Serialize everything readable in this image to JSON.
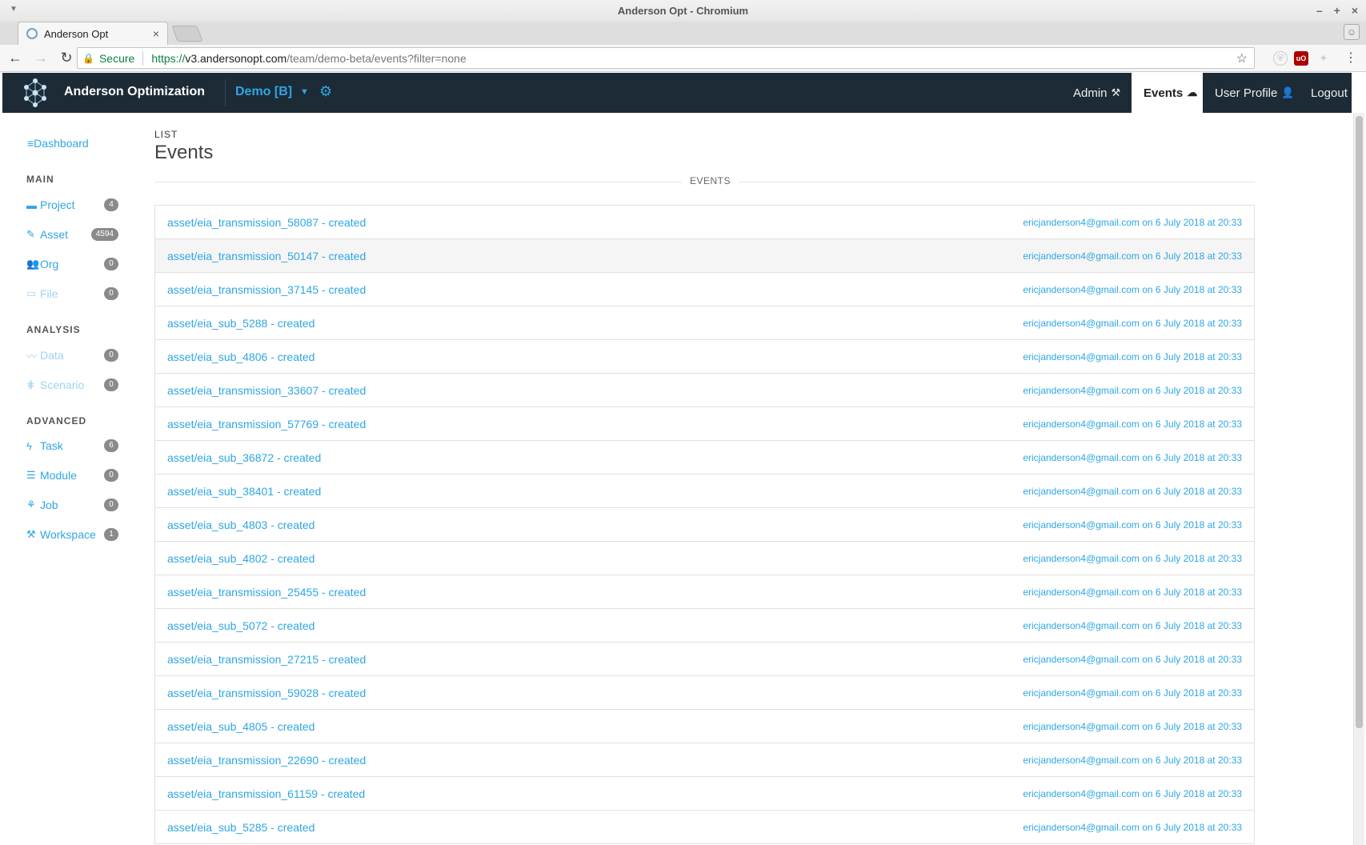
{
  "browser": {
    "window_title": "Anderson Opt - Chromium",
    "tab_title": "Anderson Opt",
    "secure_label": "Secure",
    "url_scheme": "https://",
    "url_host": "v3.andersonopt.com",
    "url_path": "/team/demo-beta/events?filter=none"
  },
  "nav": {
    "brand": "Anderson Optimization",
    "team": "Demo [B]",
    "links": {
      "admin": "Admin",
      "events": "Events",
      "profile": "User Profile",
      "logout": "Logout"
    }
  },
  "sidebar": {
    "dashboard": "Dashboard",
    "sections": {
      "main": "MAIN",
      "analysis": "ANALYSIS",
      "advanced": "ADVANCED"
    },
    "main": [
      {
        "label": "Project",
        "count": "4",
        "icon": "folder-icon"
      },
      {
        "label": "Asset",
        "count": "4594",
        "icon": "pencil-icon"
      },
      {
        "label": "Org",
        "count": "0",
        "icon": "users-icon"
      },
      {
        "label": "File",
        "count": "0",
        "icon": "hdd-icon"
      }
    ],
    "analysis": [
      {
        "label": "Data",
        "count": "0",
        "icon": "chart-icon"
      },
      {
        "label": "Scenario",
        "count": "0",
        "icon": "sliders-icon"
      }
    ],
    "advanced": [
      {
        "label": "Task",
        "count": "6",
        "icon": "bolt-icon"
      },
      {
        "label": "Module",
        "count": "0",
        "icon": "database-icon"
      },
      {
        "label": "Job",
        "count": "0",
        "icon": "sitemap-icon"
      },
      {
        "label": "Workspace",
        "count": "1",
        "icon": "tools-icon"
      }
    ]
  },
  "page": {
    "crumb": "LIST",
    "title": "Events",
    "section_label": "EVENTS"
  },
  "events": [
    {
      "title": "asset/eia_transmission_58087 - created",
      "meta": "ericjanderson4@gmail.com on 6 July 2018 at 20:33"
    },
    {
      "title": "asset/eia_transmission_50147 - created",
      "meta": "ericjanderson4@gmail.com on 6 July 2018 at 20:33"
    },
    {
      "title": "asset/eia_transmission_37145 - created",
      "meta": "ericjanderson4@gmail.com on 6 July 2018 at 20:33"
    },
    {
      "title": "asset/eia_sub_5288 - created",
      "meta": "ericjanderson4@gmail.com on 6 July 2018 at 20:33"
    },
    {
      "title": "asset/eia_sub_4806 - created",
      "meta": "ericjanderson4@gmail.com on 6 July 2018 at 20:33"
    },
    {
      "title": "asset/eia_transmission_33607 - created",
      "meta": "ericjanderson4@gmail.com on 6 July 2018 at 20:33"
    },
    {
      "title": "asset/eia_transmission_57769 - created",
      "meta": "ericjanderson4@gmail.com on 6 July 2018 at 20:33"
    },
    {
      "title": "asset/eia_sub_36872 - created",
      "meta": "ericjanderson4@gmail.com on 6 July 2018 at 20:33"
    },
    {
      "title": "asset/eia_sub_38401 - created",
      "meta": "ericjanderson4@gmail.com on 6 July 2018 at 20:33"
    },
    {
      "title": "asset/eia_sub_4803 - created",
      "meta": "ericjanderson4@gmail.com on 6 July 2018 at 20:33"
    },
    {
      "title": "asset/eia_sub_4802 - created",
      "meta": "ericjanderson4@gmail.com on 6 July 2018 at 20:33"
    },
    {
      "title": "asset/eia_transmission_25455 - created",
      "meta": "ericjanderson4@gmail.com on 6 July 2018 at 20:33"
    },
    {
      "title": "asset/eia_sub_5072 - created",
      "meta": "ericjanderson4@gmail.com on 6 July 2018 at 20:33"
    },
    {
      "title": "asset/eia_transmission_27215 - created",
      "meta": "ericjanderson4@gmail.com on 6 July 2018 at 20:33"
    },
    {
      "title": "asset/eia_transmission_59028 - created",
      "meta": "ericjanderson4@gmail.com on 6 July 2018 at 20:33"
    },
    {
      "title": "asset/eia_sub_4805 - created",
      "meta": "ericjanderson4@gmail.com on 6 July 2018 at 20:33"
    },
    {
      "title": "asset/eia_transmission_22690 - created",
      "meta": "ericjanderson4@gmail.com on 6 July 2018 at 20:33"
    },
    {
      "title": "asset/eia_transmission_61159 - created",
      "meta": "ericjanderson4@gmail.com on 6 July 2018 at 20:33"
    },
    {
      "title": "asset/eia_sub_5285 - created",
      "meta": "ericjanderson4@gmail.com on 6 July 2018 at 20:33"
    }
  ],
  "colors": {
    "accent": "#2ea6e3",
    "navbar": "#1d2b36",
    "badge": "#8a8a8a"
  }
}
